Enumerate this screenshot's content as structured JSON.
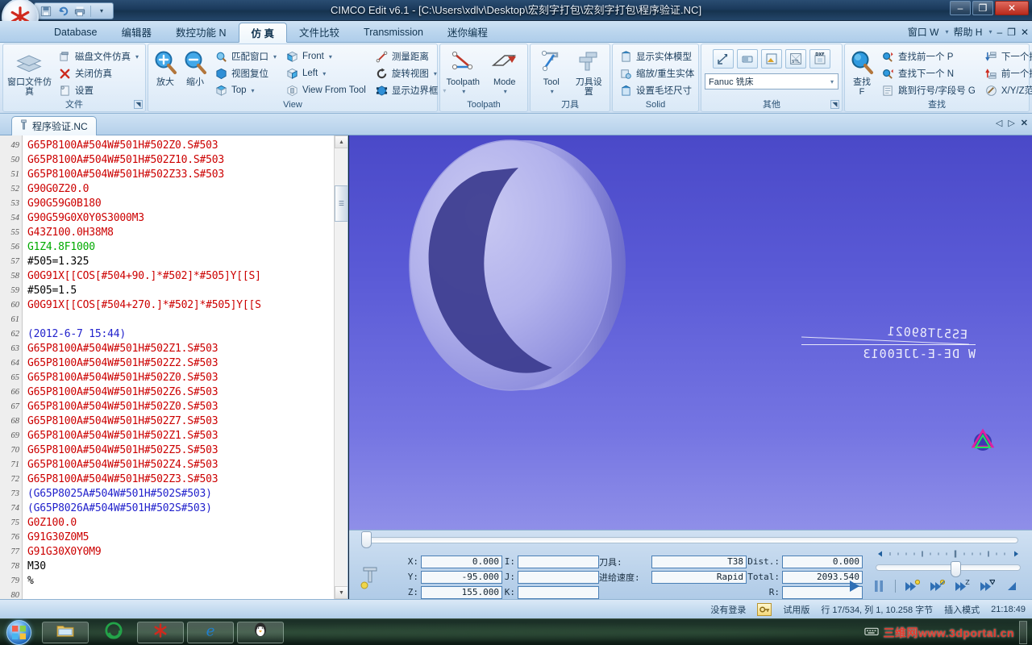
{
  "window": {
    "title": "CIMCO Edit v6.1 - [C:\\Users\\xdlv\\Desktop\\宏刻字打包\\宏刻字打包\\程序验证.NC]",
    "minimize": "–",
    "maximize": "❐",
    "close": "✕"
  },
  "quick_access": {
    "save": "save-icon",
    "undo": "undo-icon",
    "print": "print-icon",
    "more": "▾"
  },
  "menu": {
    "items": [
      {
        "label": "Database",
        "active": false
      },
      {
        "label": "编辑器",
        "active": false
      },
      {
        "label": "数控功能 N",
        "active": false
      },
      {
        "label": "仿 真",
        "active": true
      },
      {
        "label": "文件比较",
        "active": false
      },
      {
        "label": "Transmission",
        "active": false
      },
      {
        "label": "迷你编程",
        "active": false
      }
    ],
    "right": [
      {
        "label": "窗口 W",
        "caret": "▾"
      },
      {
        "label": "帮助 H",
        "caret": "▾"
      }
    ]
  },
  "ribbon": {
    "groups": [
      {
        "title": "文件",
        "has_dialog_launcher": true,
        "big": [
          {
            "label": "窗口文件仿真",
            "icon": "layers-icon"
          }
        ],
        "small": [
          {
            "label": "磁盘文件仿真",
            "icon": "disk-file-icon",
            "caret": "▾"
          },
          {
            "label": "关闭仿真",
            "icon": "close-red-x-icon",
            "caret": ""
          },
          {
            "label": "设置",
            "icon": "settings-page-icon",
            "caret": ""
          }
        ]
      },
      {
        "title": "View",
        "has_dialog_launcher": false,
        "big": [
          {
            "label": "放大",
            "icon": "zoom-in-icon"
          },
          {
            "label": "缩小",
            "icon": "zoom-out-icon"
          }
        ],
        "small": [
          {
            "label": "匹配窗口",
            "icon": "fit-window-icon",
            "caret": "▾"
          },
          {
            "label": "视图复位",
            "icon": "cube-blue-icon",
            "caret": ""
          },
          {
            "label": "Top",
            "icon": "cube-top-icon",
            "caret": "▾"
          }
        ],
        "small2": [
          {
            "label": "Front",
            "icon": "cube-front-icon",
            "caret": "▾"
          },
          {
            "label": "Left",
            "icon": "cube-left-icon",
            "caret": "▾"
          },
          {
            "label": "View From Tool",
            "icon": "cube-tool-icon",
            "caret": ""
          }
        ],
        "small3": [
          {
            "label": "测量距离",
            "icon": "measure-icon",
            "caret": ""
          },
          {
            "label": "旋转视图",
            "icon": "rotate-view-icon",
            "caret": "▾"
          },
          {
            "label": "显示边界框",
            "icon": "bounding-box-icon",
            "caret": "▾"
          }
        ]
      },
      {
        "title": "Toolpath",
        "has_dialog_launcher": false,
        "big": [
          {
            "label": "Toolpath",
            "icon": "toolpath-icon",
            "caret": "▾"
          },
          {
            "label": "Mode",
            "icon": "mode-icon",
            "caret": "▾"
          }
        ],
        "small": []
      },
      {
        "title": "刀具",
        "has_dialog_launcher": false,
        "big": [
          {
            "label": "Tool",
            "icon": "tool-icon",
            "caret": "▾"
          },
          {
            "label": "刀具设置",
            "icon": "tool-settings-icon"
          }
        ],
        "small": []
      },
      {
        "title": "Solid",
        "has_dialog_launcher": false,
        "big": [],
        "small": [
          {
            "label": "显示实体模型",
            "icon": "show-solid-icon",
            "caret": ""
          },
          {
            "label": "缩放/重生实体",
            "icon": "rescale-solid-icon",
            "caret": ""
          },
          {
            "label": "设置毛坯尺寸",
            "icon": "stock-size-icon",
            "caret": ""
          }
        ]
      },
      {
        "title": "其他",
        "has_dialog_launcher": true,
        "icon_buttons": [
          {
            "name": "graph-icon"
          },
          {
            "name": "tape-icon"
          },
          {
            "name": "export-icon"
          },
          {
            "name": "stl-icon"
          },
          {
            "name": "dxf-icon"
          }
        ],
        "combo": {
          "value": "Fanuc 铣床",
          "caret": "▾"
        }
      },
      {
        "title": "查找",
        "has_dialog_launcher": false,
        "big": [
          {
            "label": "查找\nF",
            "icon": "find-magnifier-icon"
          }
        ],
        "small": [
          {
            "label": "查找前一个 P",
            "icon": "find-prev-icon",
            "caret": ""
          },
          {
            "label": "查找下一个 N",
            "icon": "find-next-icon",
            "caret": ""
          },
          {
            "label": "跳到行号/字段号 G",
            "icon": "goto-line-icon",
            "caret": ""
          }
        ],
        "small2": [
          {
            "label": "下一个换刀 T",
            "icon": "next-toolchange-icon",
            "caret": ""
          },
          {
            "label": "前一个换刀 P",
            "icon": "prev-toolchange-icon",
            "caret": ""
          },
          {
            "label": "X/Y/Z范围 F",
            "icon": "xyz-range-icon",
            "caret": ""
          }
        ]
      }
    ]
  },
  "doctab": {
    "label": "程序验证.NC",
    "icon": "nc-file-icon",
    "controls": {
      "prev": "◁",
      "next": "▷",
      "close": "✕"
    }
  },
  "editor": {
    "lines": [
      {
        "n": "49",
        "text": "G65P8100A#504W#501H#502Z0.S#503",
        "color": "red"
      },
      {
        "n": "50",
        "text": "G65P8100A#504W#501H#502Z10.S#503",
        "color": "red"
      },
      {
        "n": "51",
        "text": "G65P8100A#504W#501H#502Z33.S#503",
        "color": "red"
      },
      {
        "n": "52",
        "text": "G90G0Z20.0",
        "color": "red"
      },
      {
        "n": "53",
        "text": "G90G59G0B180",
        "color": "red"
      },
      {
        "n": "54",
        "text": "G90G59G0X0Y0S3000M3",
        "color": "red"
      },
      {
        "n": "55",
        "text": "G43Z100.0H38M8",
        "color": "red"
      },
      {
        "n": "56",
        "text": "G1Z4.8F1000",
        "color": "green"
      },
      {
        "n": "57",
        "text": "#505=1.325",
        "color": "black"
      },
      {
        "n": "58",
        "text": "G0G91X[[COS[#504+90.]*#502]*#505]Y[[S]",
        "color": "red"
      },
      {
        "n": "59",
        "text": "#505=1.5",
        "color": "black"
      },
      {
        "n": "60",
        "text": "G0G91X[[COS[#504+270.]*#502]*#505]Y[[S",
        "color": "red"
      },
      {
        "n": "61",
        "text": "",
        "color": "black"
      },
      {
        "n": "62",
        "text": "(2012-6-7 15:44)",
        "color": "blue"
      },
      {
        "n": "63",
        "text": "G65P8100A#504W#501H#502Z1.S#503",
        "color": "red"
      },
      {
        "n": "64",
        "text": "G65P8100A#504W#501H#502Z2.S#503",
        "color": "red"
      },
      {
        "n": "65",
        "text": "G65P8100A#504W#501H#502Z0.S#503",
        "color": "red"
      },
      {
        "n": "66",
        "text": "G65P8100A#504W#501H#502Z6.S#503",
        "color": "red"
      },
      {
        "n": "67",
        "text": "G65P8100A#504W#501H#502Z0.S#503",
        "color": "red"
      },
      {
        "n": "68",
        "text": "G65P8100A#504W#501H#502Z7.S#503",
        "color": "red"
      },
      {
        "n": "69",
        "text": "G65P8100A#504W#501H#502Z1.S#503",
        "color": "red"
      },
      {
        "n": "70",
        "text": "G65P8100A#504W#501H#502Z5.S#503",
        "color": "red"
      },
      {
        "n": "71",
        "text": "G65P8100A#504W#501H#502Z4.S#503",
        "color": "red"
      },
      {
        "n": "72",
        "text": "G65P8100A#504W#501H#502Z3.S#503",
        "color": "red"
      },
      {
        "n": "73",
        "text": "(G65P8025A#504W#501H#502S#503)",
        "color": "blue"
      },
      {
        "n": "74",
        "text": "(G65P8026A#504W#501H#502S#503)",
        "color": "blue"
      },
      {
        "n": "75",
        "text": "G0Z100.0",
        "color": "red"
      },
      {
        "n": "76",
        "text": "G91G30Z0M5",
        "color": "red"
      },
      {
        "n": "77",
        "text": "G91G30X0Y0M9",
        "color": "red"
      },
      {
        "n": "78",
        "text": "M30",
        "color": "black"
      },
      {
        "n": "79",
        "text": "%",
        "color": "black"
      },
      {
        "n": "80",
        "text": "",
        "color": "black"
      }
    ]
  },
  "view3d": {
    "engraved_line1": "ES5JT89021",
    "engraved_line2": "W DE-E-JJE0013",
    "tool_marker": "tool-position-marker"
  },
  "sim_panel": {
    "axes": [
      {
        "label": "X:",
        "value": "0.000"
      },
      {
        "label": "Y:",
        "value": "-95.000"
      },
      {
        "label": "Z:",
        "value": "155.000"
      }
    ],
    "ijk": [
      {
        "label": "I:",
        "value": ""
      },
      {
        "label": "J:",
        "value": ""
      },
      {
        "label": "K:",
        "value": ""
      }
    ],
    "info_left": [
      {
        "label": "刀具:",
        "value": "T38"
      },
      {
        "label": "进给速度:",
        "value": "Rapid"
      }
    ],
    "info_right": [
      {
        "label": "Dist.:",
        "value": "0.000"
      },
      {
        "label": "Total:",
        "value": "2093.540"
      },
      {
        "label": "R:",
        "value": ""
      }
    ],
    "transport": [
      {
        "name": "play-button",
        "glyph": "▶"
      },
      {
        "name": "pause-button",
        "glyph": "❙❙"
      },
      {
        "name": "step-block-button",
        "glyph": "▶▶"
      },
      {
        "name": "step-move-button",
        "glyph": "▶▶"
      },
      {
        "name": "step-z-button",
        "glyph": "▶▶"
      },
      {
        "name": "step-tool-button",
        "glyph": "▶▶"
      }
    ],
    "speed_slider_label": "speed-slider"
  },
  "statusbar": {
    "login": "没有登录",
    "license": "试用版",
    "position": "行 17/534, 列 1, 10.258 字节",
    "mode": "插入模式",
    "time": "21:18:49"
  },
  "taskbar": {
    "start": "start-orb",
    "apps": [
      {
        "name": "explorer-icon"
      },
      {
        "name": "edge-icon"
      },
      {
        "name": "cimco-icon"
      },
      {
        "name": "internet-explorer-icon"
      },
      {
        "name": "qq-icon"
      }
    ],
    "tray_text": "三维网www.3dportal.cn",
    "tray_icon": "keyboard-icon"
  },
  "colors": {
    "accent": "#2a4d72",
    "ribbon_bg": "#dbe9f7",
    "code_red": "#cc0000",
    "code_blue": "#2222cc",
    "code_green": "#00aa00",
    "view_bg": "#5a5ad6"
  }
}
